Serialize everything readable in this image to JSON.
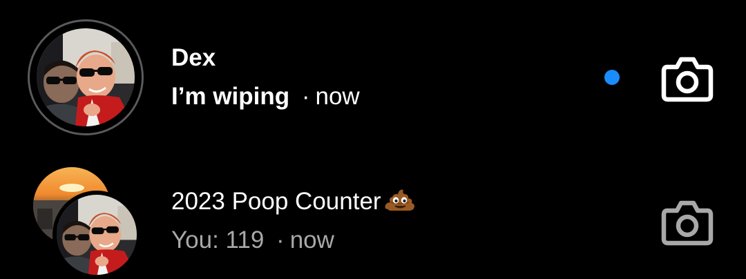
{
  "threads": [
    {
      "name": "Dex",
      "message": "I’m wiping",
      "separator": "·",
      "time": "now",
      "unread": true,
      "avatar_icon": "profile-photo",
      "action_icon": "camera-icon"
    },
    {
      "name": "2023 Poop Counter",
      "name_emoji_icon": "poop-emoji-icon",
      "message": "You: 119",
      "separator": "·",
      "time": "now",
      "unread": false,
      "avatar_icon": "group-photo",
      "action_icon": "camera-icon"
    }
  ],
  "colors": {
    "background": "#000000",
    "primary_text": "#ffffff",
    "secondary_text": "#a8a8a8",
    "unread_dot": "#1a8cff",
    "story_ring": "#5a5a5a"
  }
}
